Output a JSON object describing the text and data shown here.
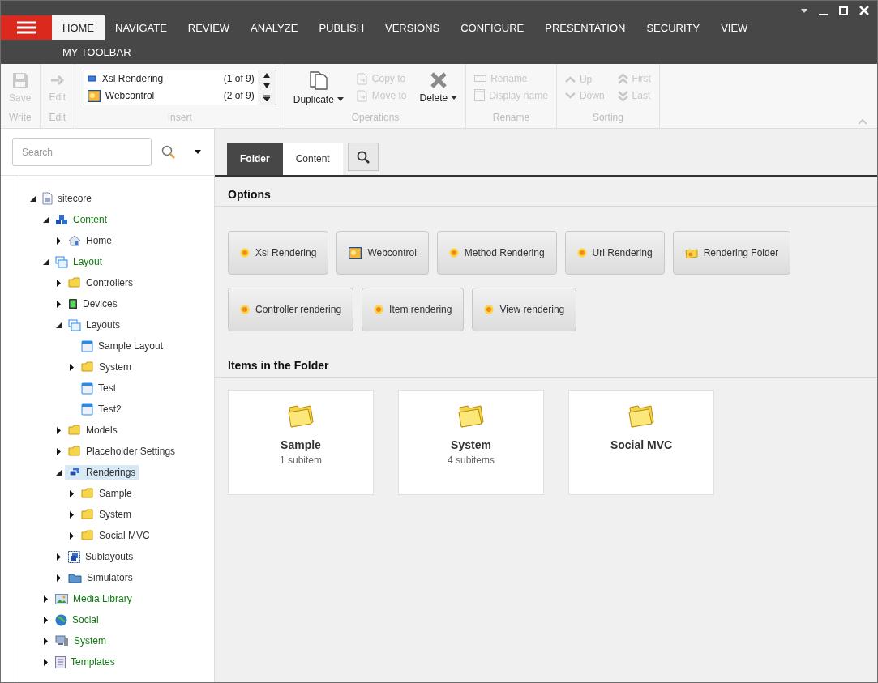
{
  "menu": {
    "rows": [
      [
        {
          "label": "HOME",
          "selected": true
        },
        {
          "label": "NAVIGATE",
          "selected": false
        },
        {
          "label": "REVIEW",
          "selected": false
        },
        {
          "label": "ANALYZE",
          "selected": false
        },
        {
          "label": "PUBLISH",
          "selected": false
        },
        {
          "label": "VERSIONS",
          "selected": false
        },
        {
          "label": "CONFIGURE",
          "selected": false
        },
        {
          "label": "PRESENTATION",
          "selected": false
        },
        {
          "label": "SECURITY",
          "selected": false
        },
        {
          "label": "VIEW",
          "selected": false
        }
      ],
      [
        {
          "label": "MY TOOLBAR",
          "selected": false
        }
      ]
    ]
  },
  "ribbon": {
    "groups": [
      {
        "label": "Write",
        "items": [
          {
            "kind": "large",
            "label": "Save",
            "disabled": true,
            "dropdown": false
          }
        ]
      },
      {
        "label": "Edit",
        "items": [
          {
            "kind": "large",
            "label": "Edit",
            "disabled": true,
            "dropdown": false
          }
        ]
      },
      {
        "label": "Insert",
        "items": [
          {
            "kind": "gallery",
            "entries": [
              {
                "label": "Xsl Rendering",
                "count": "(1 of 9)"
              },
              {
                "label": "Webcontrol",
                "count": "(2 of 9)"
              }
            ]
          }
        ]
      },
      {
        "label": "Operations",
        "items": [
          {
            "kind": "large",
            "label": "Duplicate",
            "disabled": false,
            "dropdown": true
          },
          {
            "kind": "stack",
            "entries": [
              {
                "label": "Copy to",
                "disabled": true
              },
              {
                "label": "Move to",
                "disabled": true
              }
            ]
          },
          {
            "kind": "large",
            "label": "Delete",
            "disabled": false,
            "dropdown": true
          }
        ]
      },
      {
        "label": "Rename",
        "items": [
          {
            "kind": "stack",
            "entries": [
              {
                "label": "Rename",
                "disabled": true
              },
              {
                "label": "Display name",
                "disabled": true
              }
            ]
          }
        ]
      },
      {
        "label": "Sorting",
        "items": [
          {
            "kind": "stack",
            "entries": [
              {
                "label": "Up",
                "disabled": true
              },
              {
                "label": "Down",
                "disabled": true
              }
            ]
          },
          {
            "kind": "stack",
            "entries": [
              {
                "label": "First",
                "disabled": true
              },
              {
                "label": "Last",
                "disabled": true
              }
            ]
          }
        ]
      }
    ]
  },
  "search": {
    "placeholder": "Search"
  },
  "tree": [
    {
      "label": "sitecore",
      "kind": "document",
      "expanded": true,
      "selected": false,
      "children": [
        {
          "label": "Content",
          "kind": "cubes",
          "expanded": true,
          "selected": false,
          "children": [
            {
              "label": "Home",
              "kind": "home",
              "expanded": false,
              "selected": false
            }
          ]
        },
        {
          "label": "Layout",
          "kind": "windows",
          "expanded": true,
          "selected": false,
          "children": [
            {
              "label": "Controllers",
              "kind": "folder",
              "expanded": false,
              "selected": false
            },
            {
              "label": "Devices",
              "kind": "device",
              "expanded": false,
              "selected": false
            },
            {
              "label": "Layouts",
              "kind": "windows",
              "expanded": true,
              "selected": false,
              "children": [
                {
                  "label": "Sample Layout",
                  "kind": "layout",
                  "selected": false
                },
                {
                  "label": "System",
                  "kind": "folder",
                  "expanded": false,
                  "selected": false
                },
                {
                  "label": "Test",
                  "kind": "layout",
                  "selected": false
                },
                {
                  "label": "Test2",
                  "kind": "layout",
                  "selected": false
                }
              ]
            },
            {
              "label": "Models",
              "kind": "folder",
              "expanded": false,
              "selected": false
            },
            {
              "label": "Placeholder Settings",
              "kind": "folder",
              "expanded": false,
              "selected": false
            },
            {
              "label": "Renderings",
              "kind": "renderings",
              "expanded": true,
              "selected": true,
              "children": [
                {
                  "label": "Sample",
                  "kind": "folder",
                  "expanded": false,
                  "selected": false
                },
                {
                  "label": "System",
                  "kind": "folder",
                  "expanded": false,
                  "selected": false
                },
                {
                  "label": "Social MVC",
                  "kind": "folder",
                  "expanded": false,
                  "selected": false
                }
              ]
            },
            {
              "label": "Sublayouts",
              "kind": "sublayout",
              "expanded": false,
              "selected": false
            },
            {
              "label": "Simulators",
              "kind": "simulator",
              "expanded": false,
              "selected": false
            }
          ]
        },
        {
          "label": "Media Library",
          "kind": "media",
          "expanded": false,
          "selected": false
        },
        {
          "label": "Social",
          "kind": "globe",
          "expanded": false,
          "selected": false
        },
        {
          "label": "System",
          "kind": "system",
          "expanded": false,
          "selected": false
        },
        {
          "label": "Templates",
          "kind": "template",
          "expanded": false,
          "selected": false
        }
      ]
    }
  ],
  "editor_tabs": [
    {
      "label": "Folder",
      "selected": true
    },
    {
      "label": "Content",
      "selected": false
    }
  ],
  "options": {
    "title": "Options",
    "buttons": [
      {
        "label": "Xsl Rendering",
        "kind": "rendering"
      },
      {
        "label": "Webcontrol",
        "kind": "webcontrol"
      },
      {
        "label": "Method Rendering",
        "kind": "rendering"
      },
      {
        "label": "Url Rendering",
        "kind": "rendering"
      },
      {
        "label": "Rendering Folder",
        "kind": "renderingfolder"
      },
      {
        "label": "Controller rendering",
        "kind": "rendering"
      },
      {
        "label": "Item rendering",
        "kind": "rendering"
      },
      {
        "label": "View rendering",
        "kind": "rendering"
      }
    ]
  },
  "folder_items": {
    "title": "Items in the Folder",
    "items": [
      {
        "name": "Sample",
        "subitems": "1 subitem"
      },
      {
        "name": "System",
        "subitems": "4 subitems"
      },
      {
        "name": "Social MVC"
      }
    ]
  }
}
